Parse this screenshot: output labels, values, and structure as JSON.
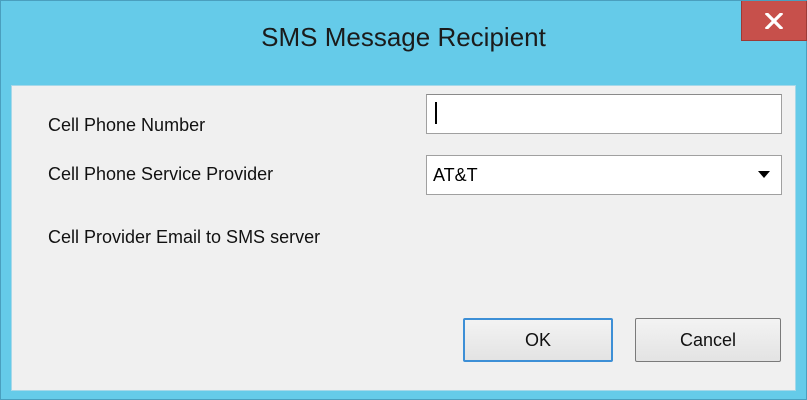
{
  "window": {
    "title": "SMS Message Recipient"
  },
  "form": {
    "phone_label": "Cell Phone Number",
    "phone_value": "",
    "provider_label": "Cell Phone Service Provider",
    "provider_selected": "AT&T",
    "server_label": "Cell Provider Email to SMS server"
  },
  "buttons": {
    "ok_label": "OK",
    "cancel_label": "Cancel"
  },
  "icons": {
    "close": "close-icon",
    "dropdown": "chevron-down-icon"
  },
  "colors": {
    "titlebar": "#65cbe9",
    "close_button": "#c7504b",
    "client_background": "#f0f0f0",
    "default_button_border": "#3d8fd6"
  }
}
